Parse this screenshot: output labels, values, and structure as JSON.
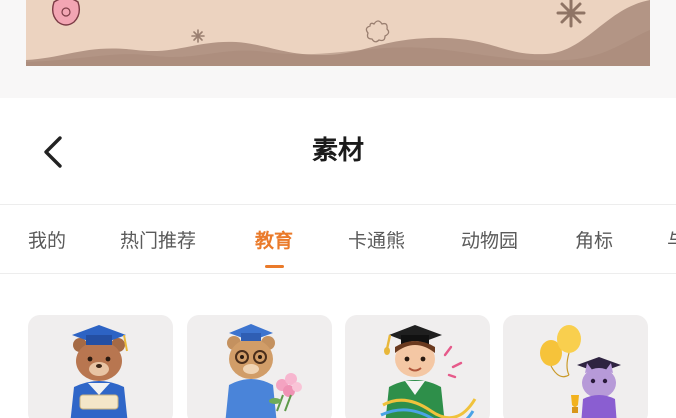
{
  "header": {
    "title": "素材"
  },
  "tabs": [
    {
      "label": "我的",
      "active": false
    },
    {
      "label": "热门推荐",
      "active": false
    },
    {
      "label": "教育",
      "active": true
    },
    {
      "label": "卡通熊",
      "active": false
    },
    {
      "label": "动物园",
      "active": false
    },
    {
      "label": "角标",
      "active": false
    },
    {
      "label": "与",
      "active": false
    }
  ],
  "colors": {
    "accent": "#ea7a2a",
    "banner": "#ecd3c0",
    "banner_wave": "#b59a8a"
  },
  "stickers": [
    {
      "icon": "graduate-bear-diploma-icon"
    },
    {
      "icon": "graduate-bear-flowers-icon"
    },
    {
      "icon": "graduate-student-confetti-icon"
    },
    {
      "icon": "graduate-cat-trophy-balloons-icon"
    }
  ]
}
